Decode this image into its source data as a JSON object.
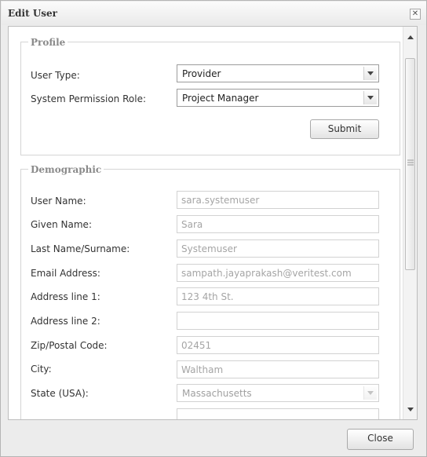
{
  "dialog": {
    "title": "Edit User",
    "close_icon": "close-x-icon"
  },
  "profile": {
    "legend": "Profile",
    "user_type_label": "User Type:",
    "user_type_value": "Provider",
    "role_label": "System Permission Role:",
    "role_value": "Project Manager",
    "submit_label": "Submit"
  },
  "demographic": {
    "legend": "Demographic",
    "fields": [
      {
        "label": "User Name:",
        "value": "sara.systemuser"
      },
      {
        "label": "Given Name:",
        "value": "Sara"
      },
      {
        "label": "Last Name/Surname:",
        "value": "Systemuser"
      },
      {
        "label": "Email Address:",
        "value": "sampath.jayaprakash@veritest.com"
      },
      {
        "label": "Address line 1:",
        "value": "123 4th St."
      },
      {
        "label": "Address line 2:",
        "value": ""
      },
      {
        "label": "Zip/Postal Code:",
        "value": "02451"
      },
      {
        "label": "City:",
        "value": "Waltham"
      },
      {
        "label": "State (USA):",
        "value": "Massachusetts"
      }
    ]
  },
  "footer": {
    "close_label": "Close"
  },
  "icons": {
    "dropdown": "chevron-down-icon",
    "scroll_up": "arrow-up-icon",
    "scroll_down": "arrow-down-icon"
  }
}
